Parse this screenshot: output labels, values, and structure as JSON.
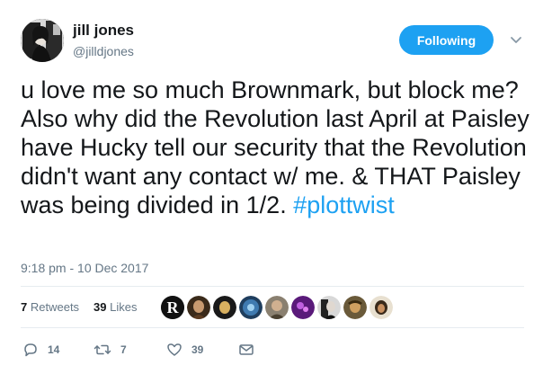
{
  "user": {
    "display_name": "jill jones",
    "handle": "@jilldjones",
    "avatar_icon": "profile-photo"
  },
  "follow_button": {
    "label": "Following",
    "color": "#1da1f2"
  },
  "menu": {
    "icon": "chevron-down-icon"
  },
  "tweet": {
    "text": "u love me so much Brownmark, but block me? Also why did the Revolution last April at Paisley have Hucky tell our security that the Revolution didn't want any contact w/ me. & THAT Paisley was being divided in 1/2.",
    "hashtag": "#plottwist",
    "timestamp": "9:18 pm - 10 Dec 2017"
  },
  "stats": {
    "retweets_count": "7",
    "retweets_label": "Retweets",
    "likes_count": "39",
    "likes_label": "Likes"
  },
  "likers": [
    {
      "name": "R",
      "color": "#1a1a1a"
    },
    {
      "name": "",
      "color": "#6b5a4a"
    },
    {
      "name": "",
      "color": "#c8a040"
    },
    {
      "name": "",
      "color": "#2a5a8a"
    },
    {
      "name": "",
      "color": "#7a7a6a"
    },
    {
      "name": "",
      "color": "#8a3aa8"
    },
    {
      "name": "",
      "color": "#3a3a3a"
    },
    {
      "name": "",
      "color": "#8a7a50"
    },
    {
      "name": "",
      "color": "#5a4a30"
    }
  ],
  "actions": {
    "reply_count": "14",
    "retweet_count": "7",
    "like_count": "39"
  },
  "colors": {
    "text": "#14171a",
    "secondary": "#657786",
    "accent": "#1da1f2",
    "divider": "#e6ecf0"
  }
}
